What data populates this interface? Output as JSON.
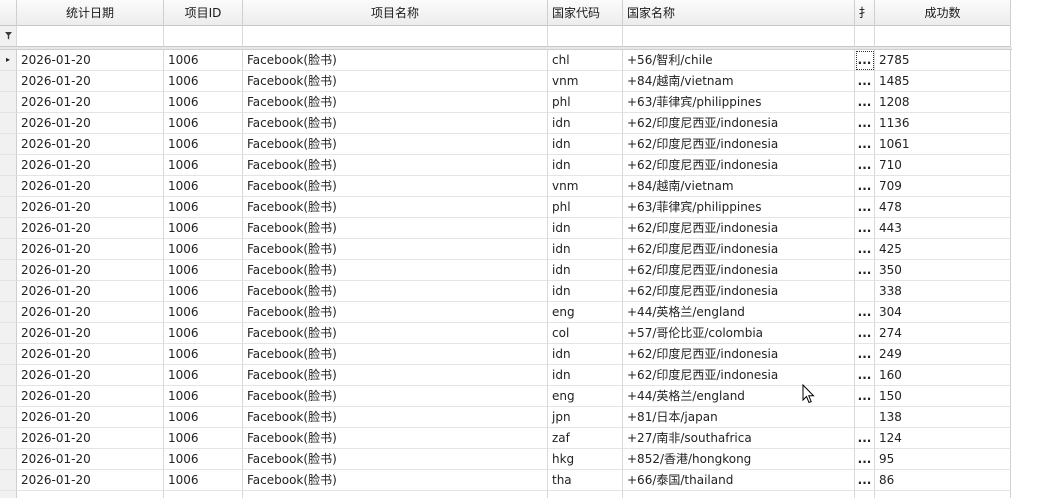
{
  "columns": {
    "date": "统计日期",
    "project_id": "项目ID",
    "project_name": "项目名称",
    "country_code": "国家代码",
    "country_name": "国家名称",
    "action": "扌",
    "success": "成功数"
  },
  "filter_icon": "filter-icon",
  "row_indicator": "▸",
  "ellipsis_label": "...",
  "rows": [
    {
      "date": "2026-01-20",
      "pid": "1006",
      "pname": "Facebook(脸书)",
      "code": "chl",
      "cname": "+56/智利/chile",
      "action": "...",
      "success": "2785"
    },
    {
      "date": "2026-01-20",
      "pid": "1006",
      "pname": "Facebook(脸书)",
      "code": "vnm",
      "cname": "+84/越南/vietnam",
      "action": "...",
      "success": "1485"
    },
    {
      "date": "2026-01-20",
      "pid": "1006",
      "pname": "Facebook(脸书)",
      "code": "phl",
      "cname": "+63/菲律宾/philippines",
      "action": "...",
      "success": "1208"
    },
    {
      "date": "2026-01-20",
      "pid": "1006",
      "pname": "Facebook(脸书)",
      "code": "idn",
      "cname": "+62/印度尼西亚/indonesia",
      "action": "...",
      "success": "1136"
    },
    {
      "date": "2026-01-20",
      "pid": "1006",
      "pname": "Facebook(脸书)",
      "code": "idn",
      "cname": "+62/印度尼西亚/indonesia",
      "action": "...",
      "success": "1061"
    },
    {
      "date": "2026-01-20",
      "pid": "1006",
      "pname": "Facebook(脸书)",
      "code": "idn",
      "cname": "+62/印度尼西亚/indonesia",
      "action": "...",
      "success": "710"
    },
    {
      "date": "2026-01-20",
      "pid": "1006",
      "pname": "Facebook(脸书)",
      "code": "vnm",
      "cname": "+84/越南/vietnam",
      "action": "...",
      "success": "709"
    },
    {
      "date": "2026-01-20",
      "pid": "1006",
      "pname": "Facebook(脸书)",
      "code": "phl",
      "cname": "+63/菲律宾/philippines",
      "action": "...",
      "success": "478"
    },
    {
      "date": "2026-01-20",
      "pid": "1006",
      "pname": "Facebook(脸书)",
      "code": "idn",
      "cname": "+62/印度尼西亚/indonesia",
      "action": "...",
      "success": "443"
    },
    {
      "date": "2026-01-20",
      "pid": "1006",
      "pname": "Facebook(脸书)",
      "code": "idn",
      "cname": "+62/印度尼西亚/indonesia",
      "action": "...",
      "success": "425"
    },
    {
      "date": "2026-01-20",
      "pid": "1006",
      "pname": "Facebook(脸书)",
      "code": "idn",
      "cname": "+62/印度尼西亚/indonesia",
      "action": "...",
      "success": "350"
    },
    {
      "date": "2026-01-20",
      "pid": "1006",
      "pname": "Facebook(脸书)",
      "code": "idn",
      "cname": "+62/印度尼西亚/indonesia",
      "action": "",
      "success": "338"
    },
    {
      "date": "2026-01-20",
      "pid": "1006",
      "pname": "Facebook(脸书)",
      "code": "eng",
      "cname": "+44/英格兰/england",
      "action": "...",
      "success": "304"
    },
    {
      "date": "2026-01-20",
      "pid": "1006",
      "pname": "Facebook(脸书)",
      "code": "col",
      "cname": "+57/哥伦比亚/colombia",
      "action": "...",
      "success": "274"
    },
    {
      "date": "2026-01-20",
      "pid": "1006",
      "pname": "Facebook(脸书)",
      "code": "idn",
      "cname": "+62/印度尼西亚/indonesia",
      "action": "...",
      "success": "249"
    },
    {
      "date": "2026-01-20",
      "pid": "1006",
      "pname": "Facebook(脸书)",
      "code": "idn",
      "cname": "+62/印度尼西亚/indonesia",
      "action": "...",
      "success": "160"
    },
    {
      "date": "2026-01-20",
      "pid": "1006",
      "pname": "Facebook(脸书)",
      "code": "eng",
      "cname": "+44/英格兰/england",
      "action": "...",
      "success": "150"
    },
    {
      "date": "2026-01-20",
      "pid": "1006",
      "pname": "Facebook(脸书)",
      "code": "jpn",
      "cname": "+81/日本/japan",
      "action": "",
      "success": "138"
    },
    {
      "date": "2026-01-20",
      "pid": "1006",
      "pname": "Facebook(脸书)",
      "code": "zaf",
      "cname": "+27/南非/southafrica",
      "action": "...",
      "success": "124"
    },
    {
      "date": "2026-01-20",
      "pid": "1006",
      "pname": "Facebook(脸书)",
      "code": "hkg",
      "cname": "+852/香港/hongkong",
      "action": "...",
      "success": "95"
    },
    {
      "date": "2026-01-20",
      "pid": "1006",
      "pname": "Facebook(脸书)",
      "code": "tha",
      "cname": "+66/泰国/thailand",
      "action": "...",
      "success": "86"
    }
  ]
}
